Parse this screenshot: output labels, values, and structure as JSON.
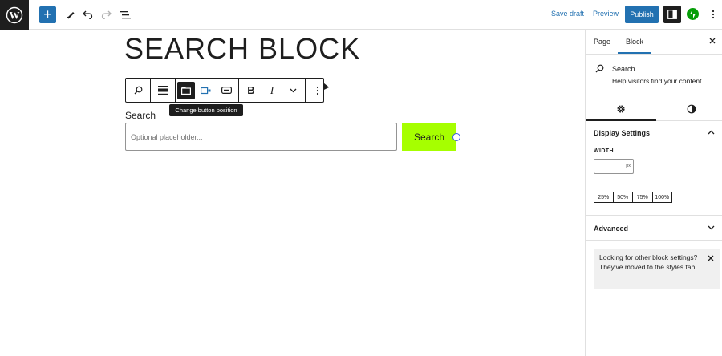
{
  "topbar": {
    "inserter_symbol": "+",
    "save_draft_label": "Save draft",
    "preview_label": "Preview",
    "publish_label": "Publish",
    "accent": "#2271b1"
  },
  "editor": {
    "heading_text": "SEARCH BLOCK",
    "toolbar": {
      "tooltip": "Change button position",
      "bold_glyph": "B",
      "italic_glyph": "I"
    },
    "search_block": {
      "label": "Search",
      "placeholder": "Optional placeholder...",
      "button_label": "Search",
      "button_color": "#a6ff00"
    }
  },
  "sidebar": {
    "tabs": [
      "Page",
      "Block"
    ],
    "active_tab": "Block",
    "block_card": {
      "title": "Search",
      "description": "Help visitors find your content."
    },
    "display_settings": {
      "title": "Display Settings",
      "width_label": "WIDTH",
      "width_unit": "px",
      "width_value": "",
      "presets": [
        "25%",
        "50%",
        "75%",
        "100%"
      ]
    },
    "advanced": {
      "title": "Advanced"
    },
    "notice": {
      "text": "Looking for other block settings? They've moved to the styles tab."
    }
  },
  "icons": [
    "wordpress-logo-icon",
    "plus-icon",
    "pen-tool-icon",
    "undo-icon",
    "redo-icon",
    "list-view-icon",
    "settings-panel-icon",
    "jetpack-icon",
    "more-vertical-icon",
    "search-icon",
    "align-icon",
    "button-position-icon",
    "button-inside-icon",
    "button-only-icon",
    "chevron-down-icon",
    "gear-icon",
    "contrast-icon",
    "close-icon",
    "chevron-up-icon"
  ]
}
